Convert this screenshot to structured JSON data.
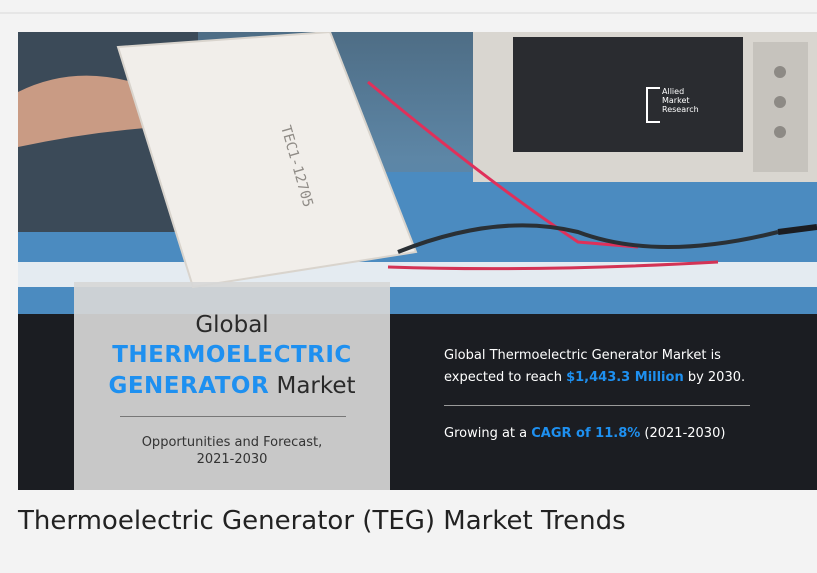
{
  "banner": {
    "module_marking": "TEC1-12705",
    "brand": {
      "line1": "Allied",
      "line2": "Market",
      "line3": "Research"
    },
    "left_panel": {
      "line1": "Global",
      "line2": "THERMOELECTRIC",
      "line3_highlight": "GENERATOR",
      "line3_rest": "Market",
      "sub1": "Opportunities and Forecast,",
      "sub2": "2021-2030"
    },
    "right_panel": {
      "line1": "Global Thermoelectric Generator Market is",
      "line2_prefix": "expected to reach ",
      "line2_value": "$1,443.3 Million",
      "line2_suffix": " by 2030.",
      "line3_prefix": "Growing at a ",
      "line3_value": "CAGR of 11.8%",
      "line3_suffix": " (2021-2030)"
    },
    "colors": {
      "accent": "#1e90f0",
      "panel_dark": "#1b1d22",
      "panel_light": "#d7d7d7"
    }
  },
  "caption": "Thermoelectric Generator (TEG) Market Trends"
}
